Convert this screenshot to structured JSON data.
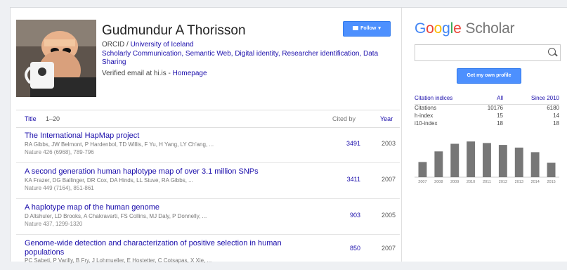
{
  "profile": {
    "name": "Gudmundur A Thorisson",
    "orcid": "ORCID",
    "affiliation": "University of Iceland",
    "interests": "Scholarly Communication, Semantic Web, Digital identity, Researcher identification, Data Sharing",
    "email_text": "Verified email at hi.is",
    "homepage_label": "Homepage",
    "follow_label": "Follow"
  },
  "table": {
    "col_title": "Title",
    "range": "1–20",
    "col_cited": "Cited by",
    "col_year": "Year"
  },
  "publications": [
    {
      "title": "The International HapMap project",
      "authors": "RA Gibbs, JW Belmont, P Hardenbol, TD Willis, F Yu, H Yang, LY Ch'ang, ...",
      "venue": "Nature 426 (6968), 789-796",
      "cited_by": "3491",
      "year": "2003"
    },
    {
      "title": "A second generation human haplotype map of over 3.1 million SNPs",
      "authors": "KA Frazer, DG Ballinger, DR Cox, DA Hinds, LL Stuve, RA Gibbs, ...",
      "venue": "Nature 449 (7164), 851-861",
      "cited_by": "3411",
      "year": "2007"
    },
    {
      "title": "A haplotype map of the human genome",
      "authors": "D Altshuler, LD Brooks, A Chakravarti, FS Collins, MJ Daly, P Donnelly, ...",
      "venue": "Nature 437, 1299-1320",
      "cited_by": "903",
      "year": "2005"
    },
    {
      "title": "Genome-wide detection and characterization of positive selection in human populations",
      "authors": "PC Sabeti, P Varilly, B Fry, J Lohmueller, E Hostetter, C Cotsapas, X Xie, ...",
      "venue": "",
      "cited_by": "850",
      "year": "2007"
    }
  ],
  "sidebar": {
    "logo_google": "Google",
    "logo_scholar": "Scholar",
    "search_placeholder": "",
    "own_profile_label": "Get my own profile",
    "citation_indices": {
      "heading": "Citation indices",
      "col_all": "All",
      "col_since": "Since 2010",
      "rows": [
        {
          "label": "Citations",
          "all": "10176",
          "since": "6180"
        },
        {
          "label": "h-index",
          "all": "15",
          "since": "14"
        },
        {
          "label": "i10-index",
          "all": "18",
          "since": "18"
        }
      ]
    }
  },
  "chart_data": {
    "type": "bar",
    "categories": [
      "2007",
      "2008",
      "2009",
      "2010",
      "2011",
      "2012",
      "2013",
      "2014",
      "2015"
    ],
    "values": [
      400,
      680,
      880,
      940,
      900,
      850,
      780,
      660,
      380
    ],
    "ylim": [
      0,
      1000
    ],
    "bar_color": "#777777"
  },
  "colors": {
    "link": "#1a0dab",
    "button": "#4d90fe"
  }
}
